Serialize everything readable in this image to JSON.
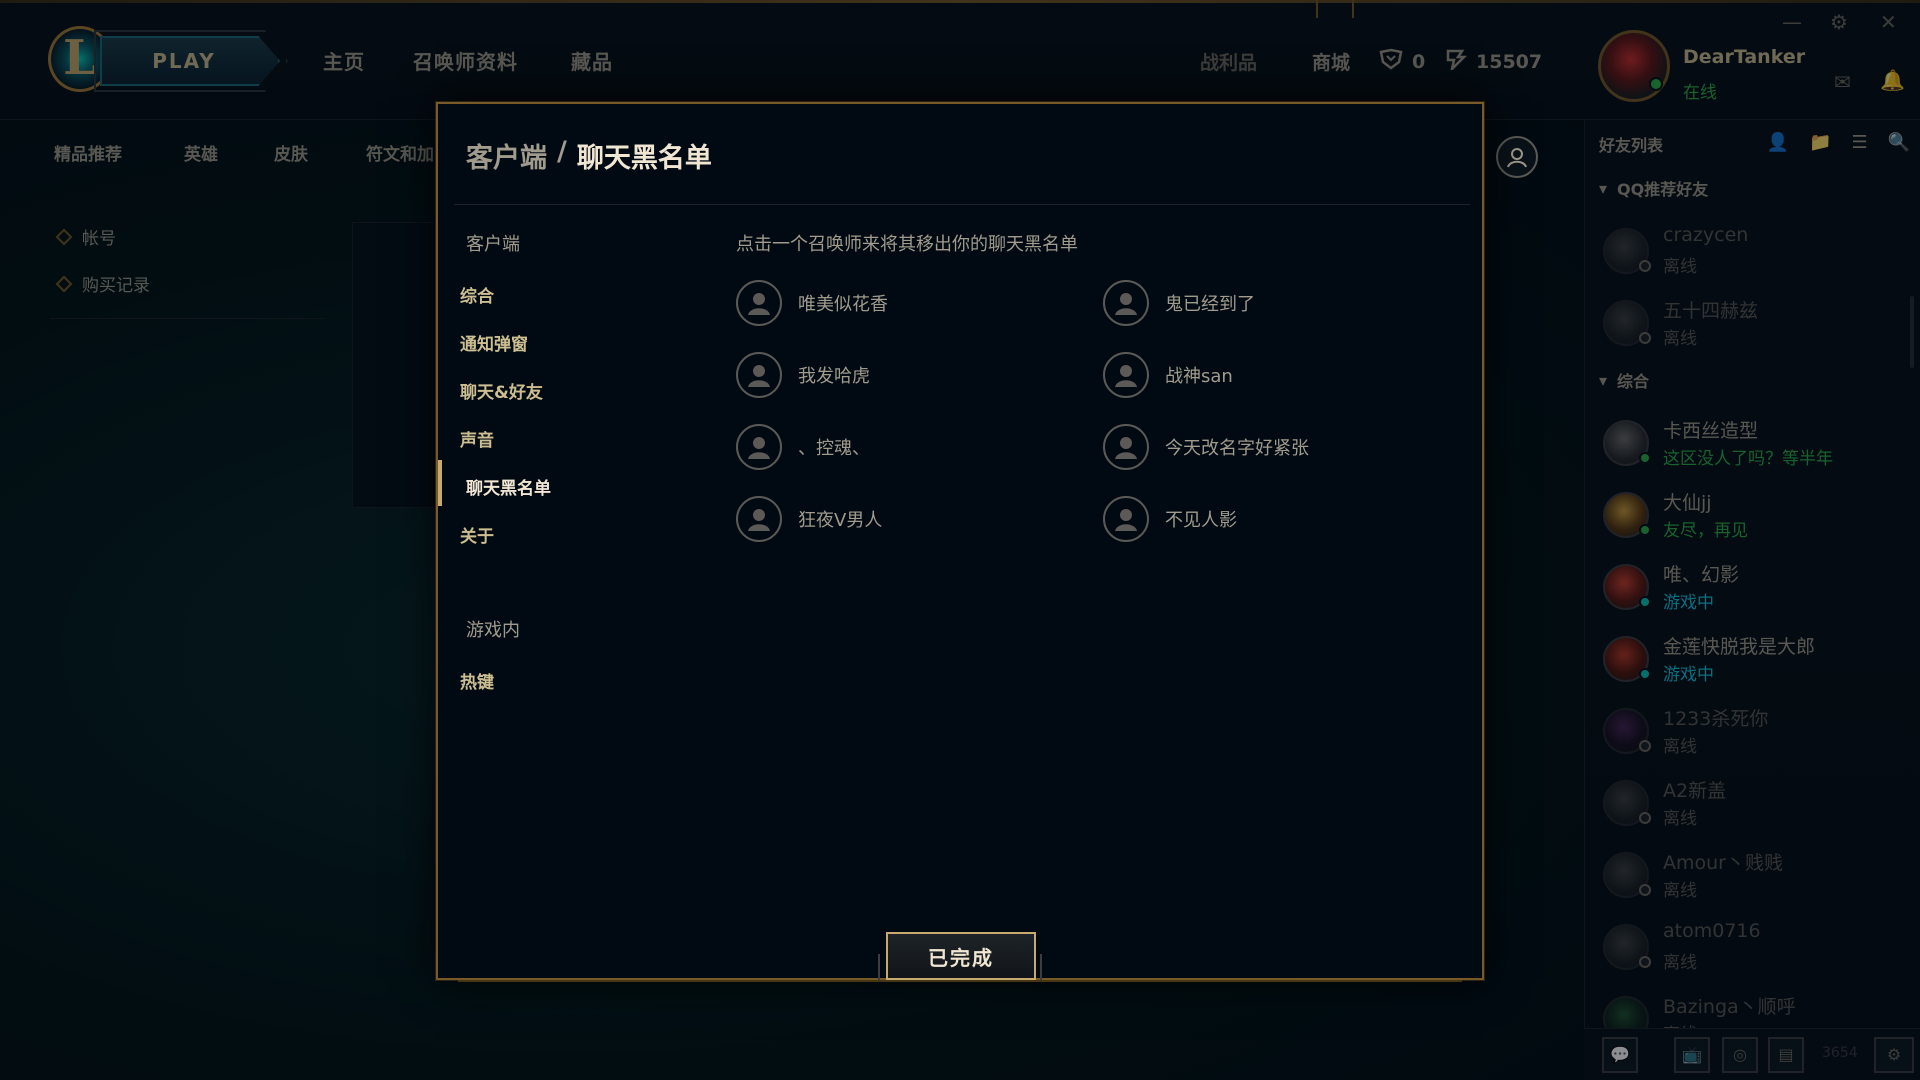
{
  "topbar": {
    "play_label": "PLAY",
    "nav": [
      "主页",
      "召唤师资料",
      "藏品"
    ],
    "loot_label": "战利品",
    "store_label": "商城",
    "rp_value": "0",
    "be_value": "15507",
    "username": "DearTanker",
    "status": "在线"
  },
  "subnav": {
    "items": [
      "精品推荐",
      "英雄",
      "皮肤",
      "符文和加"
    ]
  },
  "sidebar": {
    "items": [
      "帐号",
      "购买记录"
    ]
  },
  "friends": {
    "title": "好友列表",
    "groups": [
      {
        "label": "QQ推荐好友"
      },
      {
        "label": "综合"
      }
    ],
    "items": [
      {
        "name": "crazycen",
        "status": "离线",
        "state": "offline"
      },
      {
        "name": "五十四赫兹",
        "status": "离线",
        "state": "offline"
      },
      {
        "name": "卡西丝造型",
        "status": "这区没人了吗？等半年",
        "state": "online"
      },
      {
        "name": "大仙jj",
        "status": "友尽，再见",
        "state": "online"
      },
      {
        "name": "唯、幻影",
        "status": "游戏中",
        "state": "ingame"
      },
      {
        "name": "金莲快脱我是大郎",
        "status": "游戏中",
        "state": "ingame"
      },
      {
        "name": "1233杀死你",
        "status": "离线",
        "state": "offline"
      },
      {
        "name": "A2新盖",
        "status": "离线",
        "state": "offline"
      },
      {
        "name": "Amour丶贱贱",
        "status": "离线",
        "state": "offline"
      },
      {
        "name": "atom0716",
        "status": "离线",
        "state": "offline"
      },
      {
        "name": "Bazinga丶顺呼",
        "status": "离线",
        "state": "offline"
      }
    ],
    "footer_count": "3654"
  },
  "modal": {
    "breadcrumb_parent": "客户端",
    "breadcrumb_sep": "/",
    "breadcrumb_current": "聊天黑名单",
    "section_client": "客户端",
    "section_ingame": "游戏内",
    "menu": [
      "综合",
      "通知弹窗",
      "聊天&好友",
      "声音",
      "聊天黑名单",
      "关于"
    ],
    "menu_ingame": [
      "热键"
    ],
    "hint": "点击一个召唤师来将其移出你的聊天黑名单",
    "blocked": [
      "唯美似花香",
      "鬼已经到了",
      "我发哈虎",
      "战神san",
      "、控魂、",
      "今天改名字好紧张",
      "狂夜V男人",
      "不见人影"
    ],
    "done_label": "已完成"
  },
  "colors": {
    "gold": "#c8aa6e",
    "gold_dark": "#785a28",
    "text": "#a09b8c",
    "online": "#2ab04a",
    "ingame": "#0ac8e4",
    "bg": "#010a13"
  }
}
